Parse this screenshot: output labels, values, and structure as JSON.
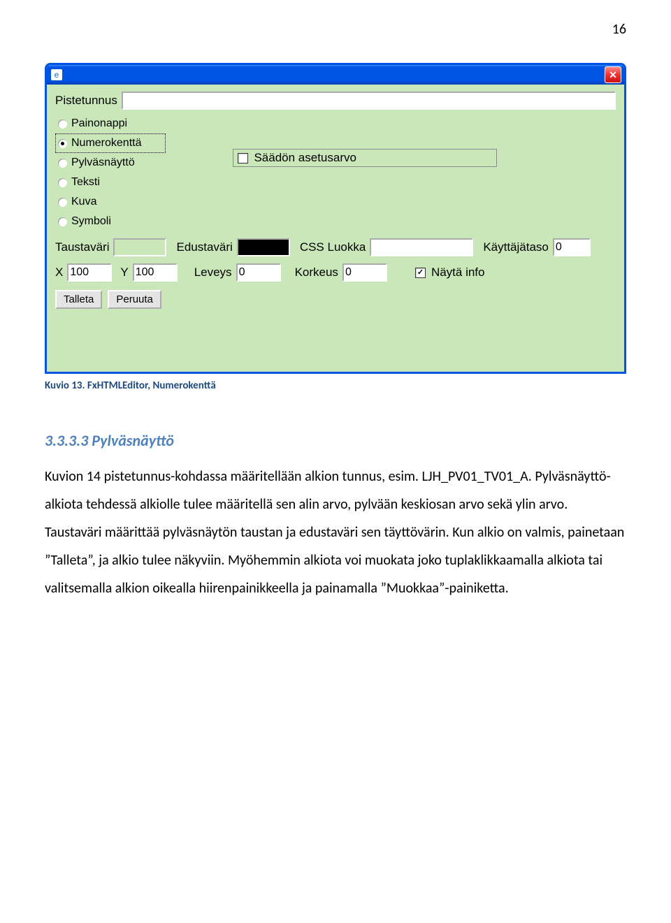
{
  "page_number": "16",
  "window": {
    "fields": {
      "pistetunnus_label": "Pistetunnus",
      "pistetunnus_value": ""
    },
    "type_options": {
      "painonappi": "Painonappi",
      "numerokentta": "Numerokenttä",
      "pylvasnaytto": "Pylväsnäyttö",
      "teksti": "Teksti",
      "kuva": "Kuva",
      "symboli": "Symboli"
    },
    "right": {
      "saadon_asetusarvo": "Säädön asetusarvo"
    },
    "row_colors": {
      "taustavari": "Taustaväri",
      "edustavari": "Edustaväri",
      "css_luokka_label": "CSS Luokka",
      "css_luokka_value": "",
      "kayttajataso_label": "Käyttäjätaso",
      "kayttajataso_value": "0"
    },
    "row_dims": {
      "x_label": "X",
      "x_value": "100",
      "y_label": "Y",
      "y_value": "100",
      "leveys_label": "Leveys",
      "leveys_value": "0",
      "korkeus_label": "Korkeus",
      "korkeus_value": "0",
      "nayta_info": "Näytä info"
    },
    "buttons": {
      "talleta": "Talleta",
      "peruuta": "Peruuta"
    }
  },
  "caption": "Kuvio 13. FxHTMLEditor, Numerokenttä",
  "heading": "3.3.3.3  Pylväsnäyttö",
  "body": "Kuvion 14 pistetunnus-kohdassa määritellään alkion tunnus, esim. LJH_PV01_TV01_A. Pylväsnäyttö-alkiota tehdessä alkiolle tulee määritellä sen alin arvo, pylvään keskiosan arvo sekä ylin arvo. Taustaväri määrittää pylväsnäytön taustan ja edustaväri sen täyttövärin. Kun alkio on valmis, painetaan ”Talleta”, ja alkio tulee näkyviin. Myöhemmin alkiota voi muokata joko tuplaklikkaamalla alkiota tai valitsemalla alkion oikealla hiirenpainikkeella ja painamalla ”Muokkaa”-painiketta."
}
